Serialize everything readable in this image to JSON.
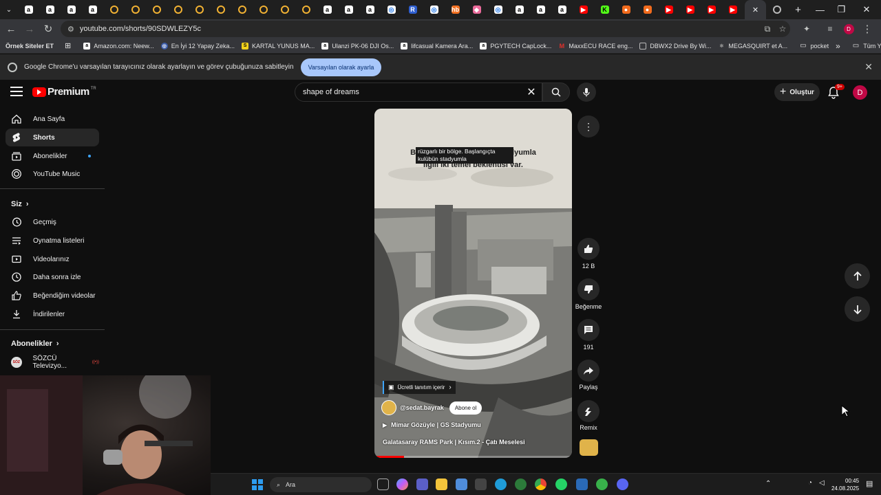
{
  "browser": {
    "tabs_favicons": [
      "amazon",
      "amazon",
      "amazon",
      "amazon",
      "loading",
      "loading",
      "loading",
      "loading",
      "loading",
      "loading",
      "loading",
      "loading",
      "loading",
      "loading",
      "amazon",
      "amazon",
      "amazon",
      "chrome",
      "r",
      "chrome",
      "hb",
      "diamond",
      "chrome",
      "amazon",
      "amazon",
      "amazon",
      "youtube",
      "kick",
      "orange",
      "orange",
      "youtube",
      "youtube",
      "youtube",
      "youtube"
    ],
    "active_tab_close": "✕",
    "new_tab": "+",
    "window_controls": [
      "—",
      "❐",
      "✕"
    ],
    "url": "youtube.com/shorts/90SDWLEZY5c",
    "bookmarks": [
      {
        "label": "Örnek Siteler ET"
      },
      {
        "label": "Amazon.com: Neew..."
      },
      {
        "label": "En İyi 12 Yapay Zeka..."
      },
      {
        "label": "KARTAL YUNUS MA..."
      },
      {
        "label": "Ulanzi PK-06 DJI Os..."
      },
      {
        "label": "lifcasual Kamera Ara..."
      },
      {
        "label": "PGYTECH CapLock..."
      },
      {
        "label": "MaxxECU RACE eng..."
      },
      {
        "label": "DBWX2 Drive By Wi..."
      },
      {
        "label": "MEGASQUIRT et A..."
      },
      {
        "label": "pocket"
      }
    ],
    "bookmarks_more": "»",
    "all_bookmarks": "Tüm Yer İşaretleri",
    "infobar_text": "Google Chrome'u varsayılan tarayıcınız olarak ayarlayın ve görev çubuğunuza sabitleyin",
    "infobar_button": "Varsayılan olarak ayarla",
    "infobar_close": "✕"
  },
  "header": {
    "logo_word": "Premium",
    "logo_sup": "TR",
    "search_value": "shape of dreams",
    "create_label": "Oluştur",
    "notif_badge": "9+",
    "avatar_letter": "D"
  },
  "sidebar": {
    "items": [
      {
        "label": "Ana Sayfa",
        "icon": "home-icon"
      },
      {
        "label": "Shorts",
        "icon": "shorts-icon"
      },
      {
        "label": "Abonelikler",
        "icon": "subscriptions-icon"
      },
      {
        "label": "YouTube Music",
        "icon": "music-icon"
      }
    ],
    "you_heading": "Siz",
    "you_items": [
      {
        "label": "Geçmiş",
        "icon": "history-icon"
      },
      {
        "label": "Oynatma listeleri",
        "icon": "playlists-icon"
      },
      {
        "label": "Videolarınız",
        "icon": "your-videos-icon"
      },
      {
        "label": "Daha sonra izle",
        "icon": "watch-later-icon"
      },
      {
        "label": "Beğendiğim videolar",
        "icon": "liked-icon"
      },
      {
        "label": "İndirilenler",
        "icon": "downloads-icon"
      }
    ],
    "subs_heading": "Abonelikler",
    "subs_items": [
      {
        "label": "SÖZCÜ Televizyo...",
        "live": "((•))"
      }
    ]
  },
  "short": {
    "caption_line1": "Bu, rüzgarlı ve kalabalık stadyumla",
    "caption_line2": "ilgili iki temel beklentisi var.",
    "caption_overlay": "rüzgarlı bir bölge. Başlangıçta kulübün stadyumla",
    "paid_promo": "Ücretli tanıtım içerir",
    "channel": "@sedat.bayrak",
    "subscribe": "Abone ol",
    "playlist": "Mimar Gözüyle | GS Stadyumu",
    "title": "Galatasaray RAMS Park | Kısım.2 - Çatı Meselesi",
    "progress": 0.15
  },
  "actions": {
    "like_count": "12 B",
    "dislike_label": "Beğenme",
    "comment_count": "191",
    "share_label": "Paylaş",
    "remix_label": "Remix"
  },
  "taskbar": {
    "search_label": "Ara",
    "time": "00:45",
    "date": "24.08.2025"
  },
  "colors": {
    "youtube_red": "#ff0000",
    "accent_blue": "#a8c7fa",
    "avatar": "#c00845"
  }
}
